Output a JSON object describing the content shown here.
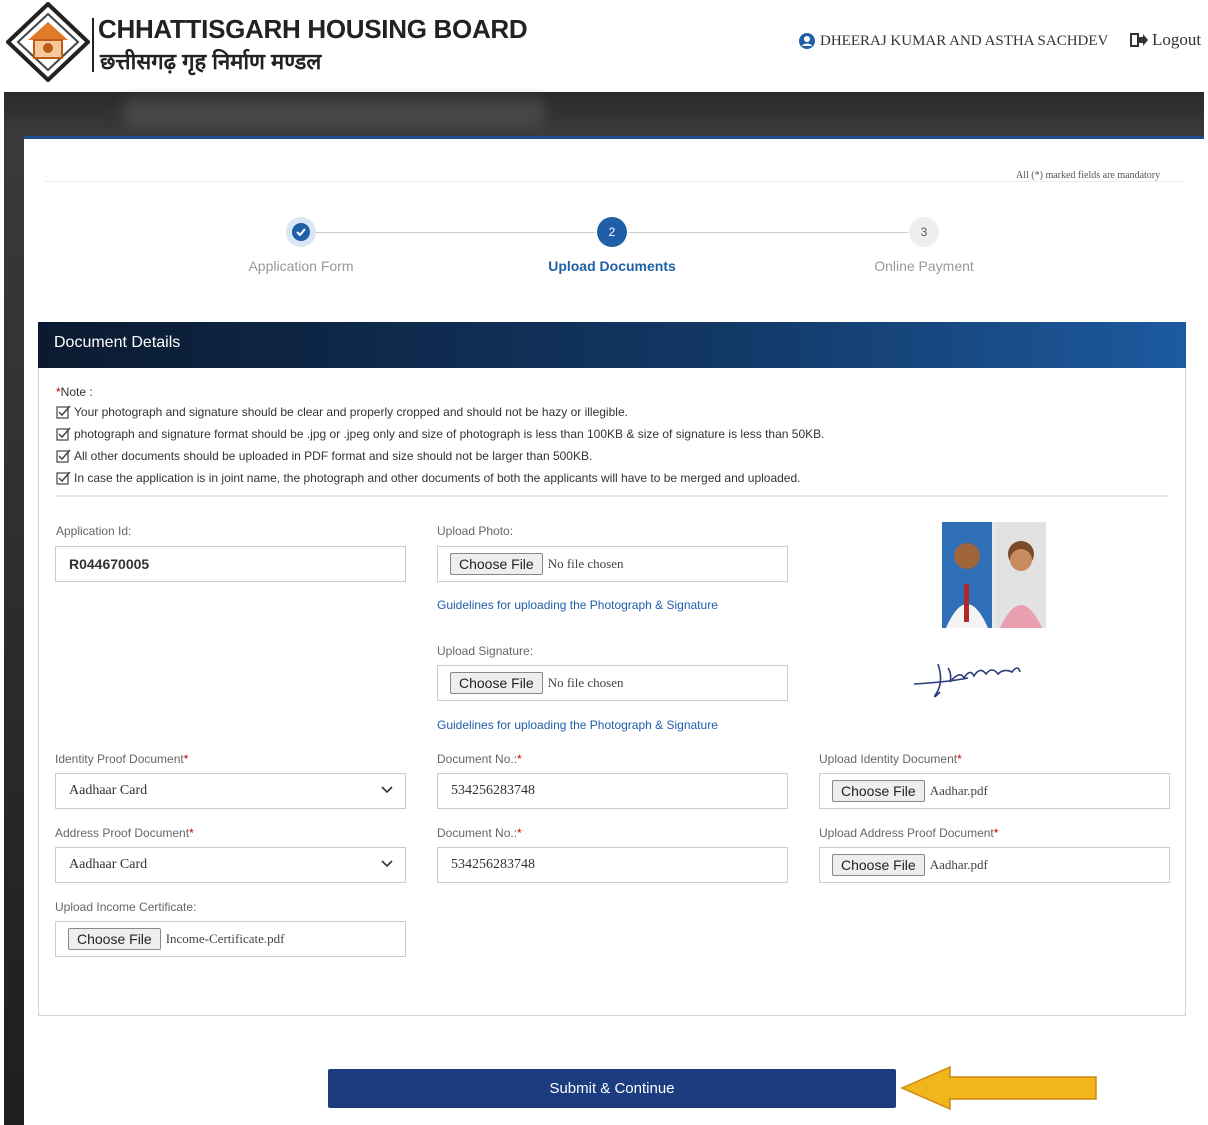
{
  "header": {
    "brand_en": "CHHATTISGARH HOUSING BOARD",
    "brand_hi": "छत्तीसगढ़ गृह निर्माण मण्डल",
    "user_name": "DHEERAJ KUMAR AND ASTHA SACHDEV",
    "logout_label": "Logout"
  },
  "mandatory_note": "All (*) marked fields are mandatory",
  "stepper": {
    "steps": [
      {
        "number": "✔",
        "label": "Application Form",
        "state": "done"
      },
      {
        "number": "2",
        "label": "Upload Documents",
        "state": "active"
      },
      {
        "number": "3",
        "label": "Online Payment",
        "state": "pending"
      }
    ]
  },
  "panel": {
    "title": "Document Details",
    "note_title": "Note :",
    "notes": [
      "Your photograph and signature should be clear and properly cropped and should not be hazy or illegible.",
      "photograph and signature format should be .jpg or .jpeg only and size of photograph is less than 100KB & size of signature is less than 50KB.",
      "All other documents should be uploaded in PDF format and size should not be larger than 500KB.",
      "In case the application is in joint name, the photograph and other documents of both the applicants will have to be merged and uploaded."
    ]
  },
  "form": {
    "application_id": {
      "label": "Application Id:",
      "value": "R044670005"
    },
    "upload_photo": {
      "label": "Upload Photo:",
      "button": "Choose File",
      "file": "No file chosen",
      "guide": "Guidelines for uploading the Photograph & Signature"
    },
    "upload_signature": {
      "label": "Upload Signature:",
      "button": "Choose File",
      "file": "No file chosen",
      "guide": "Guidelines for uploading the Photograph & Signature"
    },
    "identity_doc": {
      "label": "Identity Proof Document",
      "value": "Aadhaar Card"
    },
    "identity_no": {
      "label": "Document No.:",
      "value": "534256283748"
    },
    "identity_upload": {
      "label": "Upload Identity Document",
      "button": "Choose File",
      "file": "Aadhar.pdf"
    },
    "address_doc": {
      "label": "Address Proof Document",
      "value": "Aadhaar Card"
    },
    "address_no": {
      "label": "Document No.:",
      "value": "534256283748"
    },
    "address_upload": {
      "label": "Upload Address Proof Document",
      "button": "Choose File",
      "file": "Aadhar.pdf"
    },
    "income_upload": {
      "label": "Upload Income Certificate:",
      "button": "Choose File",
      "file": "Income-Certificate.pdf"
    }
  },
  "submit_label": "Submit & Continue",
  "colors": {
    "primary": "#1c3c80",
    "link": "#1f5fa8",
    "required": "#cc0000",
    "arrow": "#f2b51c"
  }
}
